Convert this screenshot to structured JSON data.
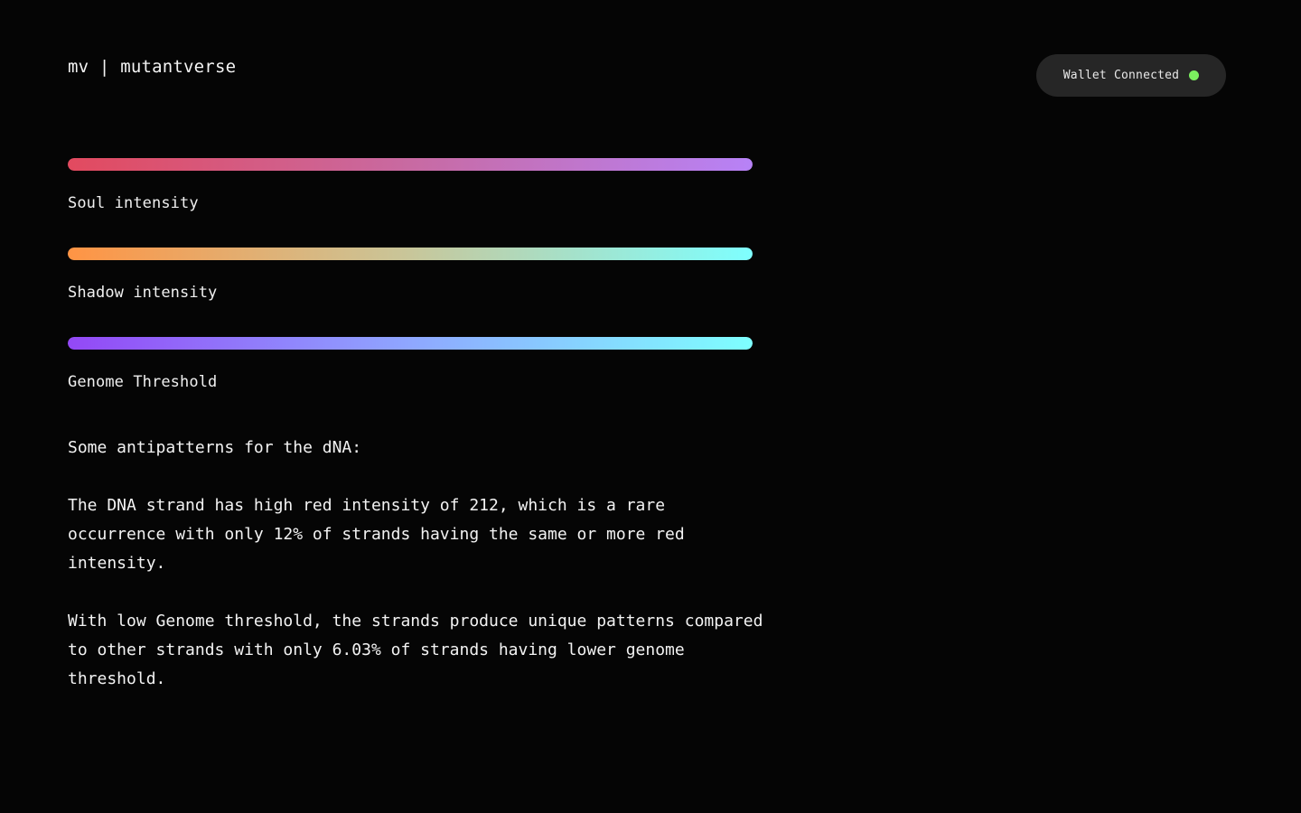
{
  "header": {
    "brand": "mv | mutantverse",
    "wallet_status": "Wallet Connected",
    "status_color": "#7cf05f"
  },
  "meters": [
    {
      "label": "Soul intensity",
      "fill": 1,
      "gradient": [
        "#e24a5f",
        "#c86aa2",
        "#b782f7"
      ]
    },
    {
      "label": "Shadow intensity",
      "fill": 1,
      "gradient": [
        "#ff9444",
        "#c8c69a",
        "#7effff"
      ]
    },
    {
      "label": "Genome Threshold",
      "fill": 1,
      "gradient": [
        "#9348f6",
        "#8fa7ff",
        "#7effff"
      ]
    }
  ],
  "notes": {
    "heading": "Some antipatterns for the dNA:",
    "paragraphs": [
      "The DNA strand has high red intensity of 212, which is a rare occurrence with only 12% of strands having the same or more red intensity.",
      "With low Genome threshold, the strands produce unique patterns compared to other strands with only 6.03% of strands having lower genome threshold."
    ]
  }
}
